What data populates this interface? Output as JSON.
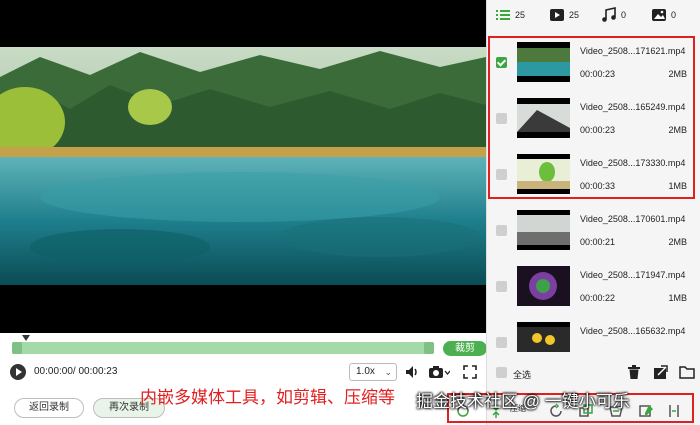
{
  "tabs": [
    {
      "icon": "list-icon",
      "count": "25"
    },
    {
      "icon": "video-icon",
      "count": "25"
    },
    {
      "icon": "music-icon",
      "count": "0"
    },
    {
      "icon": "image-icon",
      "count": "0"
    }
  ],
  "files": [
    {
      "name": "Video_2508...171621.mp4",
      "duration": "00:00:23",
      "size": "2MB",
      "checked": true
    },
    {
      "name": "Video_2508...165249.mp4",
      "duration": "00:00:23",
      "size": "2MB",
      "checked": false
    },
    {
      "name": "Video_2508...173330.mp4",
      "duration": "00:00:33",
      "size": "1MB",
      "checked": false
    },
    {
      "name": "Video_2508...170601.mp4",
      "duration": "00:00:21",
      "size": "2MB",
      "checked": false
    },
    {
      "name": "Video_2508...171947.mp4",
      "duration": "00:00:22",
      "size": "1MB",
      "checked": false
    },
    {
      "name": "Video_2508...165632.mp4",
      "duration": "",
      "size": "",
      "checked": false
    }
  ],
  "select_all_label": "全选",
  "player": {
    "cut_label": "裁剪",
    "time_text": "00:00:00/ 00:00:23",
    "speed": "1.0x",
    "back_label": "返回录制",
    "again_label": "再次录制"
  },
  "tools": {
    "compress_label": "压缩",
    "icons": [
      "convert-icon",
      "compress-icon",
      "rotate-icon",
      "crop-icon",
      "merge-icon",
      "watermark-icon",
      "split-icon",
      "more-icon"
    ]
  },
  "caption": "内嵌多媒体工具，如剪辑、压缩等",
  "watermark": "掘金技术社区 @ 一键小可乐",
  "colors": {
    "accent": "#4caf50",
    "highlight": "#e02020"
  }
}
